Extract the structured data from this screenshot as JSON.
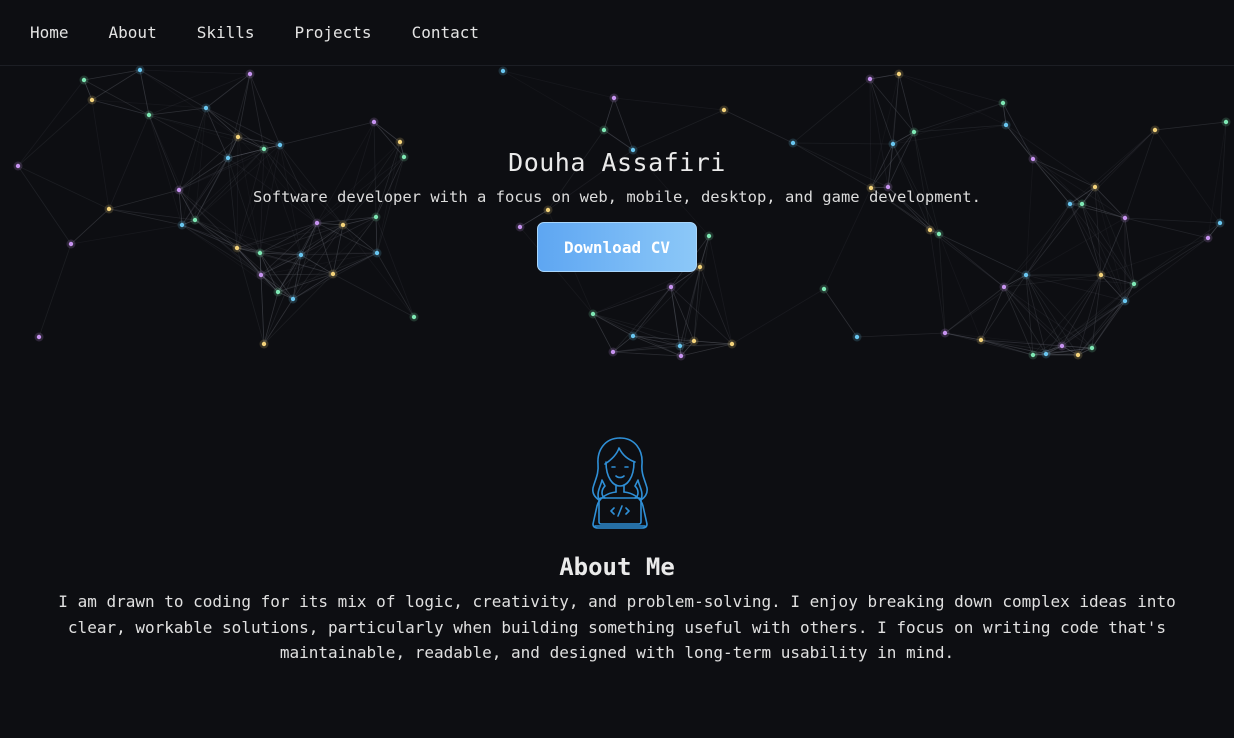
{
  "nav": {
    "items": [
      {
        "label": "Home"
      },
      {
        "label": "About"
      },
      {
        "label": "Skills"
      },
      {
        "label": "Projects"
      },
      {
        "label": "Contact"
      }
    ]
  },
  "hero": {
    "name": "Douha Assafiri",
    "tagline": "Software developer with a focus on web, mobile, desktop, and game development.",
    "cv_button": "Download CV"
  },
  "about": {
    "avatar_icon": "developer-avatar-icon",
    "title": "About Me",
    "text": "I am drawn to coding for its mix of logic, creativity, and problem-solving. I enjoy breaking down complex ideas into clear, workable solutions, particularly when building something useful with others. I focus on writing code that's maintainable, readable, and designed with long-term usability in mind."
  },
  "colors": {
    "background": "#0d0e12",
    "accent_blue": "#6fb4f4",
    "node_yellow": "#f3d27a",
    "node_purple": "#c793f0",
    "node_cyan": "#69c6f0",
    "node_green": "#7ee8b4",
    "link_line": "#6b6e78"
  }
}
